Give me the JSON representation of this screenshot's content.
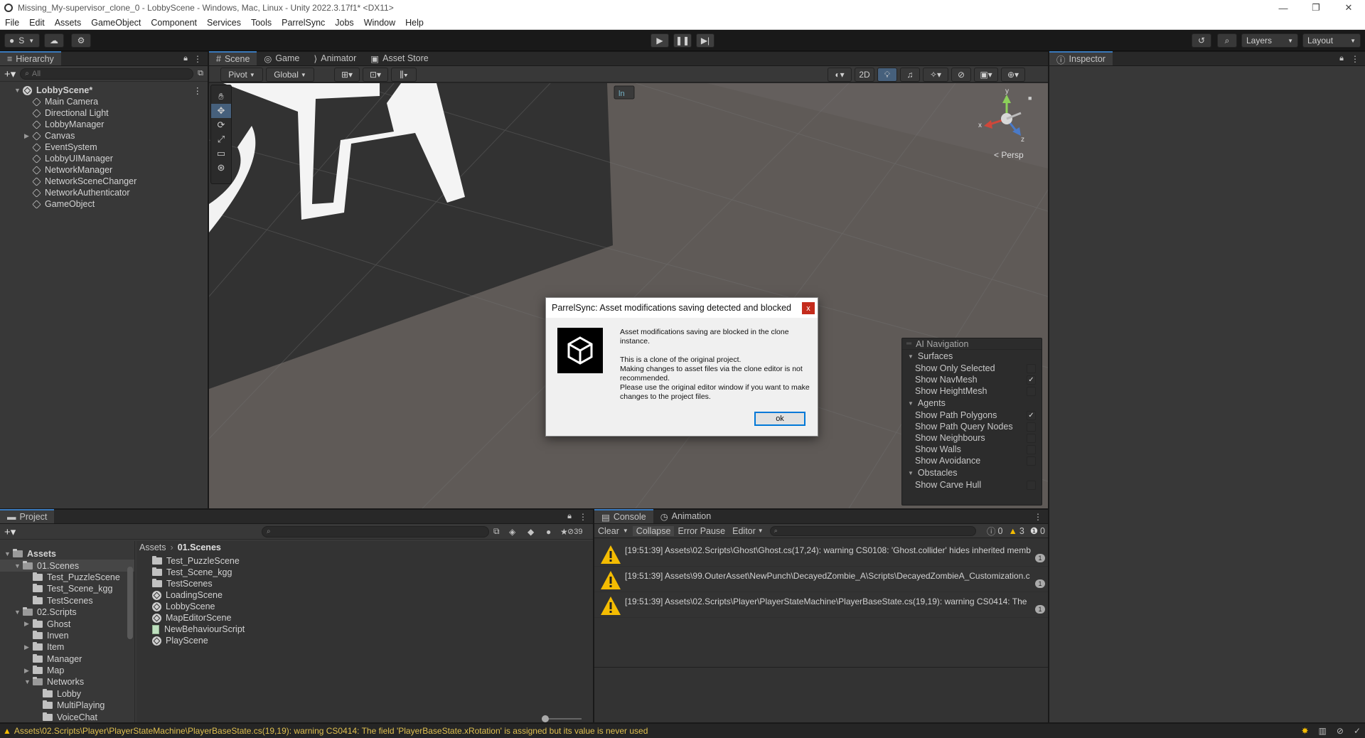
{
  "window": {
    "title": "Missing_My-supervisor_clone_0 - LobbyScene - Windows, Mac, Linux - Unity 2022.3.17f1* <DX11>",
    "controls": [
      "—",
      "❐",
      "✕"
    ]
  },
  "menu": [
    "File",
    "Edit",
    "Assets",
    "GameObject",
    "Component",
    "Services",
    "Tools",
    "ParrelSync",
    "Jobs",
    "Window",
    "Help"
  ],
  "toolbar": {
    "account_label": "S",
    "layers_label": "Layers",
    "layout_label": "Layout"
  },
  "hierarchy": {
    "tab_label": "Hierarchy",
    "search_placeholder": "All",
    "scene_name": "LobbyScene*",
    "items": [
      {
        "label": "Main Camera",
        "expandable": false
      },
      {
        "label": "Directional Light",
        "expandable": false
      },
      {
        "label": "LobbyManager",
        "expandable": false
      },
      {
        "label": "Canvas",
        "expandable": true
      },
      {
        "label": "EventSystem",
        "expandable": false
      },
      {
        "label": "LobbyUIManager",
        "expandable": false
      },
      {
        "label": "NetworkManager",
        "expandable": false
      },
      {
        "label": "NetworkSceneChanger",
        "expandable": false
      },
      {
        "label": "NetworkAuthenticator",
        "expandable": false
      },
      {
        "label": "GameObject",
        "expandable": false
      }
    ]
  },
  "scene_view": {
    "tabs": [
      "Scene",
      "Game",
      "Animator",
      "Asset Store"
    ],
    "pivot_label": "Pivot",
    "global_label": "Global",
    "mode_2d": "2D",
    "gizmo": {
      "y": "y",
      "x": "x",
      "z": "z",
      "persp": "< Persp"
    }
  },
  "ai_navigation": {
    "title": "AI Navigation",
    "sections": [
      {
        "name": "Surfaces",
        "rows": [
          {
            "label": "Show Only Selected",
            "checked": false
          },
          {
            "label": "Show NavMesh",
            "checked": true
          },
          {
            "label": "Show HeightMesh",
            "checked": false
          }
        ]
      },
      {
        "name": "Agents",
        "rows": [
          {
            "label": "Show Path Polygons",
            "checked": true
          },
          {
            "label": "Show Path Query Nodes",
            "checked": false
          },
          {
            "label": "Show Neighbours",
            "checked": false
          },
          {
            "label": "Show Walls",
            "checked": false
          },
          {
            "label": "Show Avoidance",
            "checked": false
          }
        ]
      },
      {
        "name": "Obstacles",
        "rows": [
          {
            "label": "Show Carve Hull",
            "checked": false
          }
        ]
      }
    ]
  },
  "dialog": {
    "title": "ParrelSync: Asset modifications saving detected and blocked",
    "close": "x",
    "line1": "Asset modifications saving are blocked in the clone instance.",
    "line2": "This is a clone of the original project.",
    "line3": "Making changes to asset files via the clone editor is not recommended.",
    "line4": "Please use the original editor window if you want to make changes to the project files.",
    "ok_label": "ok"
  },
  "inspector": {
    "tab_label": "Inspector"
  },
  "project": {
    "tab_label": "Project",
    "hidden_count": "39",
    "breadcrumb": [
      "Assets",
      "01.Scenes"
    ],
    "tree": [
      {
        "label": "Assets",
        "depth": 0,
        "arrow": "▼",
        "bold": true
      },
      {
        "label": "01.Scenes",
        "depth": 1,
        "arrow": "▼",
        "selected": true
      },
      {
        "label": "Test_PuzzleScene",
        "depth": 2,
        "arrow": ""
      },
      {
        "label": "Test_Scene_kgg",
        "depth": 2,
        "arrow": ""
      },
      {
        "label": "TestScenes",
        "depth": 2,
        "arrow": ""
      },
      {
        "label": "02.Scripts",
        "depth": 1,
        "arrow": "▼"
      },
      {
        "label": "Ghost",
        "depth": 2,
        "arrow": "▶"
      },
      {
        "label": "Inven",
        "depth": 2,
        "arrow": ""
      },
      {
        "label": "Item",
        "depth": 2,
        "arrow": "▶"
      },
      {
        "label": "Manager",
        "depth": 2,
        "arrow": ""
      },
      {
        "label": "Map",
        "depth": 2,
        "arrow": "▶"
      },
      {
        "label": "Networks",
        "depth": 2,
        "arrow": "▼"
      },
      {
        "label": "Lobby",
        "depth": 3,
        "arrow": ""
      },
      {
        "label": "MultiPlaying",
        "depth": 3,
        "arrow": ""
      },
      {
        "label": "VoiceChat",
        "depth": 3,
        "arrow": ""
      }
    ],
    "files": [
      {
        "label": "Test_PuzzleScene",
        "kind": "folder"
      },
      {
        "label": "Test_Scene_kgg",
        "kind": "folder"
      },
      {
        "label": "TestScenes",
        "kind": "folder"
      },
      {
        "label": "LoadingScene",
        "kind": "scene"
      },
      {
        "label": "LobbyScene",
        "kind": "scene"
      },
      {
        "label": "MapEditorScene",
        "kind": "scene"
      },
      {
        "label": "NewBehaviourScript",
        "kind": "script"
      },
      {
        "label": "PlayScene",
        "kind": "scene"
      }
    ]
  },
  "console": {
    "tabs": [
      "Console",
      "Animation"
    ],
    "clear": "Clear",
    "collapse": "Collapse",
    "error_pause": "Error Pause",
    "editor": "Editor",
    "counts": {
      "info": "0",
      "warnings": "3",
      "errors": "0"
    },
    "entries": [
      {
        "text": "[19:51:39] Assets\\02.Scripts\\Ghost\\Ghost.cs(17,24): warning CS0108: 'Ghost.collider' hides inherited memb",
        "count": "1"
      },
      {
        "text": "[19:51:39] Assets\\99.OuterAsset\\NewPunch\\DecayedZombie_A\\Scripts\\DecayedZombieA_Customization.c",
        "count": "1"
      },
      {
        "text": "[19:51:39] Assets\\02.Scripts\\Player\\PlayerStateMachine\\PlayerBaseState.cs(19,19): warning CS0414: The",
        "count": "1"
      }
    ]
  },
  "status_bar": {
    "message": "Assets\\02.Scripts\\Player\\PlayerStateMachine\\PlayerBaseState.cs(19,19): warning CS0414: The field 'PlayerBaseState.xRotation' is assigned but its value is never used"
  },
  "colors": {
    "accent": "#3a79bb",
    "warning": "#f4bc02",
    "dialog_close": "#c42b1c"
  }
}
